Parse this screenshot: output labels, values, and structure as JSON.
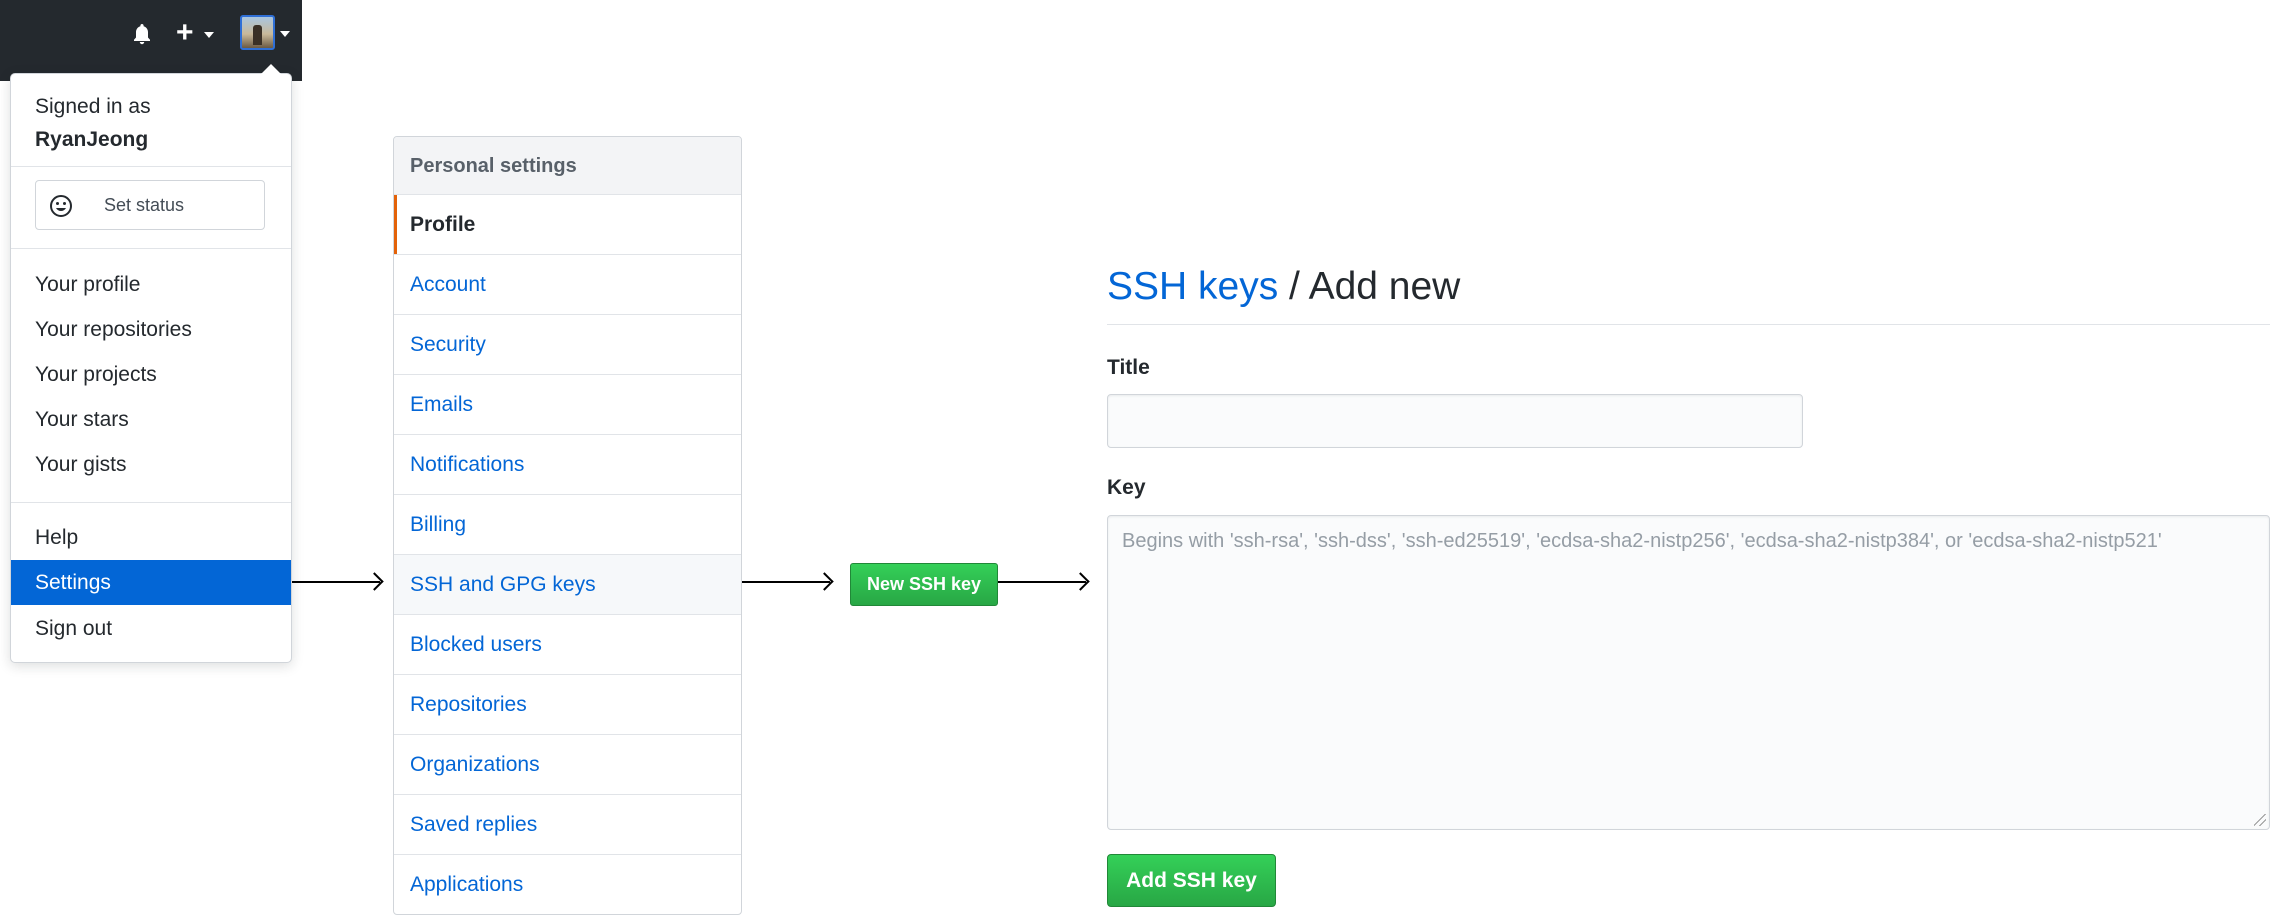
{
  "header": {
    "icons": [
      "bell-icon",
      "plus-icon",
      "avatar"
    ]
  },
  "account_menu": {
    "signed_in_prefix": "Signed in as",
    "username": "RyanJeong",
    "set_status_label": "Set status",
    "items": [
      {
        "label": "Your profile"
      },
      {
        "label": "Your repositories"
      },
      {
        "label": "Your projects"
      },
      {
        "label": "Your stars"
      },
      {
        "label": "Your gists"
      },
      {
        "label": "Help"
      },
      {
        "label": "Settings",
        "active": true
      },
      {
        "label": "Sign out"
      }
    ]
  },
  "settings_nav": {
    "header": "Personal settings",
    "items": [
      {
        "label": "Profile",
        "selected": true
      },
      {
        "label": "Account"
      },
      {
        "label": "Security"
      },
      {
        "label": "Emails"
      },
      {
        "label": "Notifications"
      },
      {
        "label": "Billing"
      },
      {
        "label": "SSH and GPG keys",
        "hovered": true
      },
      {
        "label": "Blocked users"
      },
      {
        "label": "Repositories"
      },
      {
        "label": "Organizations"
      },
      {
        "label": "Saved replies"
      },
      {
        "label": "Applications"
      }
    ]
  },
  "new_ssh_button": {
    "label": "New SSH key"
  },
  "ssh_form": {
    "breadcrumb": "SSH keys",
    "separator": " / ",
    "page_title": "Add new",
    "title_label": "Title",
    "title_value": "",
    "key_label": "Key",
    "key_placeholder": "Begins with 'ssh-rsa', 'ssh-dss', 'ssh-ed25519', 'ecdsa-sha2-nistp256', 'ecdsa-sha2-nistp384', or 'ecdsa-sha2-nistp521'",
    "submit_label": "Add SSH key"
  },
  "colors": {
    "header_bg": "#24292e",
    "link": "#0366d6",
    "active_bg": "#0366d6",
    "button_green": "#28a745",
    "selected_marker": "#e36209"
  }
}
